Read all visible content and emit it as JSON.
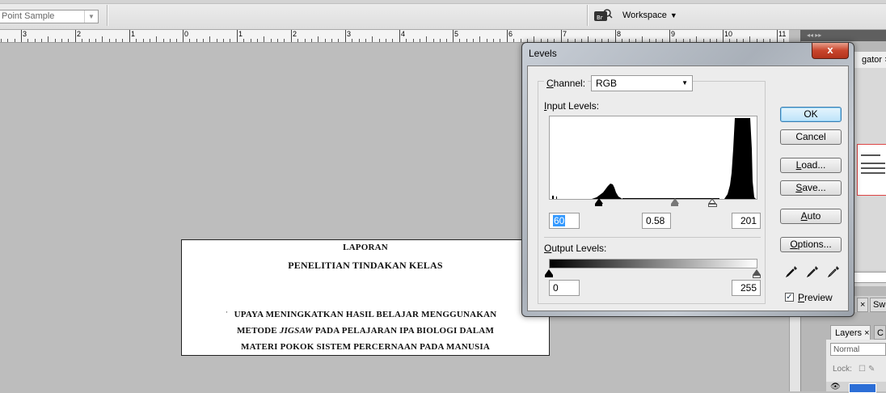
{
  "options_bar": {
    "sample_size": "Point Sample",
    "workspace_label": "Workspace"
  },
  "ruler": {
    "labels": [
      "3",
      "2",
      "1",
      "0",
      "1",
      "2",
      "3",
      "4",
      "5",
      "6",
      "7",
      "8",
      "9",
      "10",
      "11"
    ]
  },
  "side_panels": {
    "navigator_tab": "Navigator",
    "navigator_tab_visible": "gator",
    "swatches_tab_visible": "Sw",
    "layers_tab": "Layers",
    "blend_mode": "Normal",
    "lock_label": "Lock:"
  },
  "document": {
    "lines": [
      "LAPORAN",
      "PENELITIAN TINDAKAN KELAS",
      "UPAYA MENINGKATKAN HASIL BELAJAR MENGGUNAKAN",
      "METODE",
      "JIGSAW",
      "PADA PELAJARAN IPA BIOLOGI DALAM",
      "MATERI POKOK SISTEM PERCERNAAN PADA MANUSIA"
    ]
  },
  "levels_dialog": {
    "title": "Levels",
    "close_symbol": "x",
    "channel_label": "Channel:",
    "channel_value": "RGB",
    "input_levels_label": "Input Levels:",
    "input_black": "60",
    "input_gamma": "0.58",
    "input_white": "201",
    "output_levels_label": "Output Levels:",
    "output_black": "0",
    "output_white": "255",
    "buttons": {
      "ok": "OK",
      "cancel": "Cancel",
      "load": "Load...",
      "save": "Save...",
      "auto": "Auto",
      "options": "Options..."
    },
    "preview_label": "Preview",
    "preview_checked": true,
    "histogram_colors": {
      "fill": "#000000",
      "background": "#ffffff"
    }
  },
  "colors": {
    "canvas_bg": "#bdbdbd",
    "dialog_frame": "#b0b7c0",
    "close_button": "#c8452c",
    "default_button": "#bde4fa",
    "selection": "#3399ff"
  }
}
